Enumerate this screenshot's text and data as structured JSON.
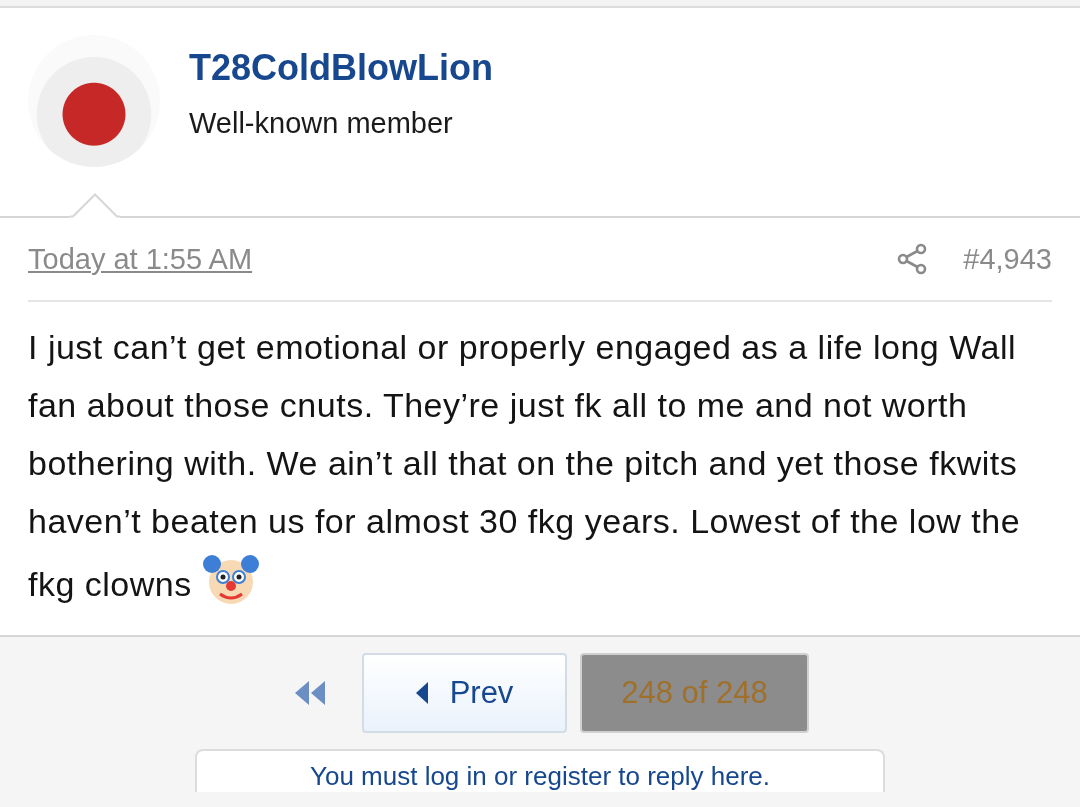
{
  "post": {
    "author": "T28ColdBlowLion",
    "role": "Well-known member",
    "date": "Today at 1:55 AM",
    "number": "#4,943",
    "body": "I just can’t get emotional or properly engaged as a life long Wall fan about those cnuts. They’re just fk all to me and not worth bothering with. We ain’t all that on the pitch and yet those fkwits haven’t beaten us for almost 30 fkg years. Lowest of the low the fkg clowns"
  },
  "pagination": {
    "prev": "Prev",
    "current": "248 of 248"
  },
  "reply_notice": "You must log in or register to reply here."
}
